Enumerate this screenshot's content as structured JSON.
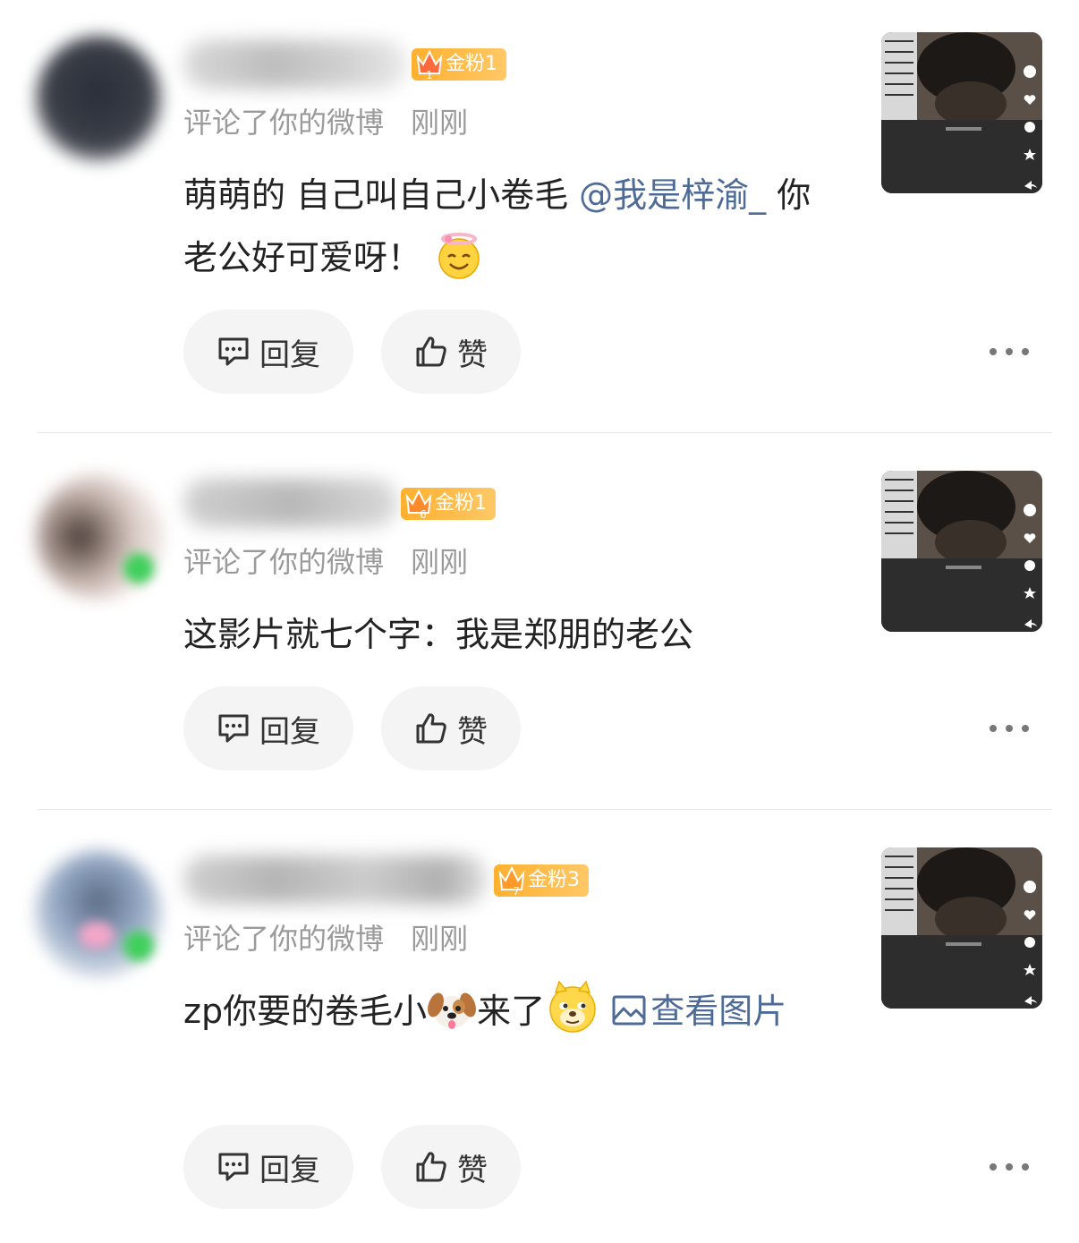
{
  "notifications": [
    {
      "badge": "金粉1",
      "badge_level": "1",
      "action": "评论了你的微博",
      "time": "刚刚",
      "content": {
        "text1": "萌萌的 自己叫自己小卷毛 ",
        "mention": "@我是梓渝_",
        "text2": " 你老公好可爱呀！"
      },
      "reply_label": "回复",
      "like_label": "赞"
    },
    {
      "badge": "金粉1",
      "badge_level": "6",
      "action": "评论了你的微博",
      "time": "刚刚",
      "content": {
        "text1": "这影片就七个字：我是郑朋的老公"
      },
      "reply_label": "回复",
      "like_label": "赞"
    },
    {
      "badge": "金粉3",
      "badge_level": "7",
      "action": "评论了你的微博",
      "time": "刚刚",
      "content": {
        "text1": "zp你要的卷毛小",
        "text2": "来了",
        "link": "查看图片"
      },
      "reply_label": "回复",
      "like_label": "赞"
    }
  ],
  "icons": {
    "reply": "comment-bubble-icon",
    "like": "thumbs-up-icon",
    "more": "more-dots-icon",
    "image": "image-icon",
    "emoji_halo": "angel-smile-emoji",
    "emoji_dog": "dog-face-emoji",
    "emoji_doge": "doge-emoji"
  },
  "colors": {
    "link": "#4d6b96",
    "meta": "#9a9a9a",
    "badge": "#ffb02e"
  }
}
